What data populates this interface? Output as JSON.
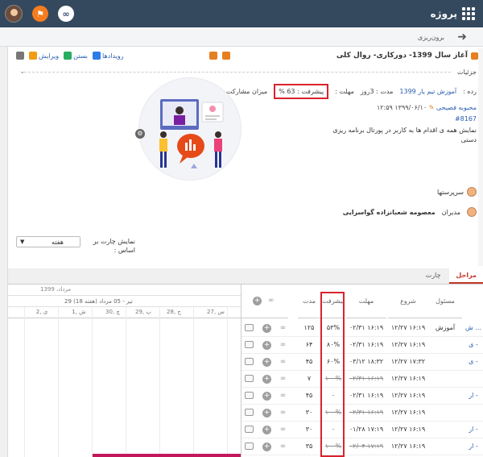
{
  "topbar": {
    "brand": "پروژه"
  },
  "header": {
    "title": "برون‌ریزی"
  },
  "task": {
    "title": "آغاز سال 1399- دورکاری- روال کلی",
    "details_label": "جزئیات",
    "actions": {
      "events": "رویدادها",
      "close": "بستن",
      "edit": "ویرایش"
    },
    "meta": {
      "category_label": "رده :",
      "category_value": "آموزش تیم یار 1399",
      "duration_label": "مدت : 3روز",
      "deadline_label": "مهلت :",
      "progress_label": "پیشرفت : 63 %",
      "participation_label": "میزان مشارکت : ۰"
    },
    "owner": "محبوبه فصیحی",
    "timestamp": "۱۳۹۹/۰۶/۱۰ ۱۲:۵۹",
    "id": "#8167",
    "description": "نمایش همه ی اقدام ها به کاربر در پورتال برنامه ریزی دستی",
    "supervisors_label": "سرپرستها",
    "managers_label": "مدیران",
    "manager_name": "معصومه شعبانزاده گواسرایی"
  },
  "chart_controls": {
    "label": "نمایش چارت بر اساس :",
    "selected": "هفته"
  },
  "tabs": [
    {
      "label": "مراحل",
      "active": true
    },
    {
      "label": "چارت",
      "active": false
    }
  ],
  "gantt": {
    "month_label": "مرداد، 1399",
    "week_label": "29 تیر - 05 مرداد (هفته 18)",
    "days": [
      "27, س",
      "28, ج",
      "29, پ",
      "30, چ",
      "1, ش",
      "2, ی"
    ]
  },
  "table": {
    "headers": {
      "owner": "مسئول",
      "start": "شروع",
      "deadline": "مهلت",
      "progress": "پیشرفت",
      "duration": "مدت"
    },
    "rows": [
      {
        "name": "ش ...",
        "owner": "آموزش",
        "start": "۱۲/۲۷ ۱۶:۱۹",
        "deadline": "۰۲/۳۱ ۱۶:۱۹",
        "progress": "۵۳%",
        "duration": "۱۲۵",
        "struck": false
      },
      {
        "name": "ی -",
        "owner": "",
        "start": "۱۲/۲۷ ۱۶:۱۹",
        "deadline": "۰۲/۳۱ ۱۶:۱۹",
        "progress": "۸۰%",
        "duration": "۶۴",
        "struck": false
      },
      {
        "name": "ی -",
        "owner": "",
        "start": "۱۲/۲۷ ۱۷:۳۲",
        "deadline": "۰۳/۱۲ ۱۸:۳۲",
        "progress": "۶۰%",
        "duration": "۴۵",
        "struck": false
      },
      {
        "name": "",
        "owner": "",
        "start": "۱۲/۲۷ ۱۶:۱۹",
        "deadline": "۰۲/۳۱ ۱۶:۱۹",
        "progress": "۱۰۰%",
        "duration": "۷",
        "struck": true
      },
      {
        "name": "ار -",
        "owner": "",
        "start": "۱۲/۲۷ ۱۶:۱۹",
        "deadline": "۰۲/۳۱ ۱۶:۱۹",
        "progress": "۰",
        "duration": "۴۵",
        "struck": false
      },
      {
        "name": "",
        "owner": "",
        "start": "۱۲/۲۷ ۱۶:۱۹",
        "deadline": "۰۲/۳۱ ۱۶:۱۹",
        "progress": "۱۰۰%",
        "duration": "۳۰",
        "struck": true
      },
      {
        "name": "ار -",
        "owner": "",
        "start": "۱۲/۲۷ ۱۶:۱۹",
        "deadline": "۰۱/۲۸ ۱۷:۱۹",
        "progress": "۰",
        "duration": "۳۰",
        "struck": false
      },
      {
        "name": "ار -",
        "owner": "",
        "start": "۱۲/۲۷ ۱۶:۱۹",
        "deadline": "۰۲/۰۴ ۱۷:۱۹",
        "progress": "۱۰۰%",
        "duration": "۳۵",
        "struck": true
      }
    ]
  }
}
